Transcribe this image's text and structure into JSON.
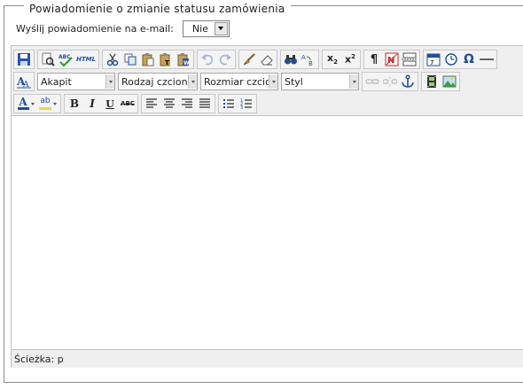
{
  "fieldset": {
    "legend": "Powiadomienie o zmianie statusu zamówienia"
  },
  "notify": {
    "label": "Wyślij powiadomienie na e-mail:",
    "value": "Nie"
  },
  "toolbar": {
    "format_value": "Akapit",
    "font_family_value": "Rodzaj czcionki",
    "font_size_value": "Rozmiar czcionki",
    "style_value": "Styl",
    "html_label": "HTML",
    "abc_label": "ABC",
    "bold_label": "B",
    "italic_label": "I",
    "underline_label": "U",
    "strike_label": "ABC",
    "subscript_label": "x",
    "superscript_label": "x",
    "omega_label": "Ω",
    "pilcrow_label": "¶",
    "text_color_label": "A",
    "highlight_label": "ab"
  },
  "status": {
    "path": "Ścieżka: p"
  },
  "colors": {
    "accent": "#1f4e9c",
    "toolbar_bg": "#efefef",
    "border": "#c2c2c2"
  }
}
